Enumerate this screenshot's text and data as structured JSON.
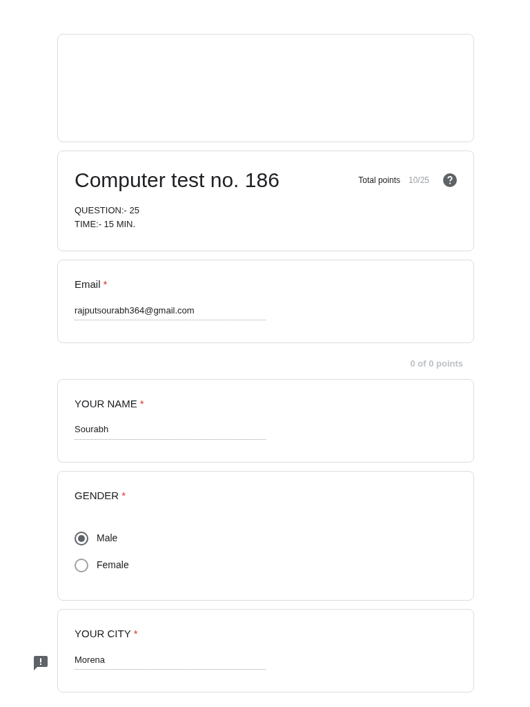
{
  "header": {
    "title": "Computer test no. 186",
    "total_points_label": "Total points",
    "total_points_value": "10/25",
    "description": [
      "QUESTION:- 25",
      "TIME:- 15 MIN."
    ]
  },
  "questions": [
    {
      "kind": "text",
      "label": "Email",
      "required_mark": "*",
      "value": "rajputsourabh364@gmail.com"
    },
    {
      "kind": "text",
      "points": "0 of 0 points",
      "label": "YOUR NAME",
      "required_mark": "*",
      "value": "Sourabh"
    },
    {
      "kind": "radio",
      "label": "GENDER",
      "required_mark": "*",
      "options": [
        {
          "label": "Male",
          "selected": true
        },
        {
          "label": "Female",
          "selected": false
        }
      ]
    },
    {
      "kind": "text",
      "label": "YOUR CITY",
      "required_mark": "*",
      "value": "Morena"
    }
  ]
}
